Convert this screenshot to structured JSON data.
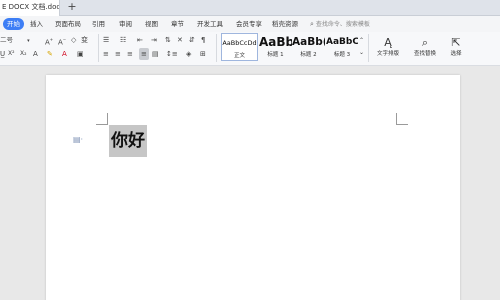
{
  "tabs": {
    "document": "E DOCX 文档.docx",
    "new_tab": "+"
  },
  "menu": {
    "items": [
      {
        "label": "开始",
        "active": true
      },
      {
        "label": "插入"
      },
      {
        "label": "页面布局"
      },
      {
        "label": "引用"
      },
      {
        "label": "审阅"
      },
      {
        "label": "视图"
      },
      {
        "label": "章节"
      },
      {
        "label": "开发工具"
      },
      {
        "label": "会员专享"
      },
      {
        "label": "稻壳资源"
      }
    ],
    "search_placeholder": "查找命令、搜索模板"
  },
  "ribbon": {
    "font_size": "二号",
    "styles": [
      {
        "sample": "AaBbCcDd",
        "label": "正文"
      },
      {
        "sample": "AaBb",
        "label": "标题 1"
      },
      {
        "sample": "AaBb(",
        "label": "标题 2"
      },
      {
        "sample": "AaBbC",
        "label": "标题 3"
      }
    ],
    "text_tools_label": "文字排版",
    "find_replace_label": "查找替换",
    "select_label": "选择"
  },
  "document": {
    "text": "你好"
  },
  "colors": {
    "accent": "#3d7ef5",
    "selection": "#c6c6c6"
  }
}
